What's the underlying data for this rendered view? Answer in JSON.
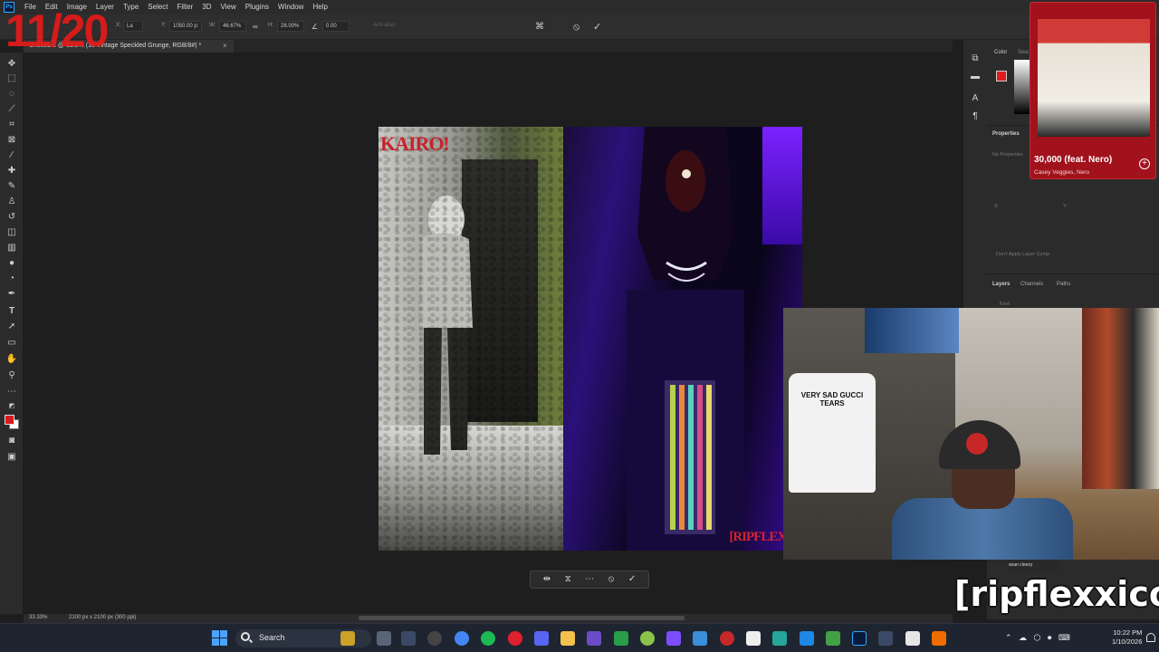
{
  "overlay": {
    "counter": "11/20",
    "watermark": "[ripflexxico]"
  },
  "menubar": {
    "app_icon": "photoshop-icon",
    "items": [
      "File",
      "Edit",
      "Image",
      "Layer",
      "Type",
      "Select",
      "Filter",
      "3D",
      "View",
      "Plugins",
      "Window",
      "Help"
    ]
  },
  "options": {
    "x_label": "X:",
    "x_value": "La",
    "y_label": "Y:",
    "y_value": "1050.00 p:",
    "w_label": "W:",
    "w_value": "46.67%",
    "h_label": "H:",
    "h_value": "28.00%",
    "angle_value": "0.00",
    "anti_alias": "Anti-alias",
    "cancel_icon": "cancel-icon",
    "commit_icon": "checkmark-icon"
  },
  "document": {
    "tab_title": "Untitled-1 @ 33.3% (10 Vintage Speckled Grunge, RGB/8#) *",
    "zoom": "33.33%",
    "info": "2100 px x 2100 px (300 ppi)"
  },
  "artwork": {
    "left_text": "KAIRO!",
    "right_text": "[RIPFLEXX]"
  },
  "transform_bar": {
    "icons": [
      "flip-icon",
      "warp-icon",
      "more-icon",
      "cancel-icon",
      "commit-icon"
    ]
  },
  "panels": {
    "color_tab": "Color",
    "swatches_tab": "Swa",
    "properties_title": "Properties",
    "no_properties": "No Properties",
    "x_label": "X:",
    "y_label": "Y:",
    "dont_apply": "Don't Apply Layer Comp",
    "layers_tab": "Layers",
    "channels_tab": "Channels",
    "paths_tab": "Paths",
    "kind_placeholder": "Kind"
  },
  "media": {
    "title": "30,000 (feat. Nero)",
    "artist": "Casey Veggies, Nero",
    "add_icon": "plus-circle-icon"
  },
  "webcam": {
    "shirt_text": "VERY SAD GUCCI TEARS",
    "tag": "sean cleezy"
  },
  "taskbar": {
    "search_label": "Search",
    "time": "10:22 PM",
    "date": "1/10/2026"
  },
  "colors": {
    "accent_red": "#e01b1b",
    "photoshop_blue": "#31a8ff",
    "media_card_bg": "#a1121c"
  }
}
